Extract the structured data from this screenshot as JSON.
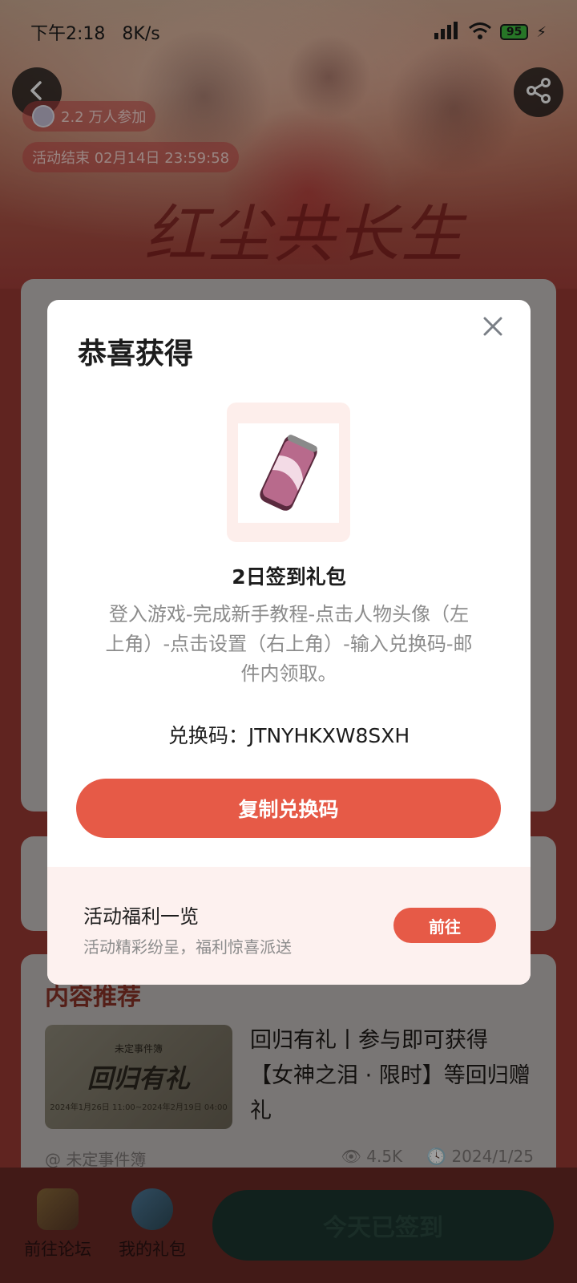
{
  "status_bar": {
    "time": "下午2:18",
    "speed": "8K/s",
    "battery": "95"
  },
  "banner": {
    "participants": "2.2 万人参加",
    "end_time": "活动结束 02月14日 23:59:58",
    "title_art": "红尘共长生"
  },
  "content": {
    "section_title": "内容推荐",
    "thumb_title": "回归有礼",
    "thumb_sub": "2024年1月26日 11:00~2024年2月19日 04:00",
    "thumb_logo": "未定事件簿",
    "article_title": "回归有礼丨参与即可获得【女神之泪 · 限时】等回归赠礼",
    "author": "@ 未定事件簿",
    "views": "4.5K",
    "date": "2024/1/25"
  },
  "bottom_nav": {
    "forum_label": "前往论坛",
    "gifts_label": "我的礼包",
    "signed_label": "今天已签到"
  },
  "modal": {
    "title": "恭喜获得",
    "gift_name": "2日签到礼包",
    "description": "登入游戏-完成新手教程-点击人物头像（左上角）-点击设置（右上角）-输入兑换码-邮件内领取。",
    "code_label": "兑换码：",
    "code": "JTNYHKXW8SXH",
    "copy_button": "复制兑换码",
    "promo_title": "活动福利一览",
    "promo_subtitle": "活动精彩纷呈，福利惊喜派送",
    "go_button": "前往"
  },
  "colors": {
    "accent": "#e65a47",
    "promo_bg": "#fdf1ef"
  }
}
